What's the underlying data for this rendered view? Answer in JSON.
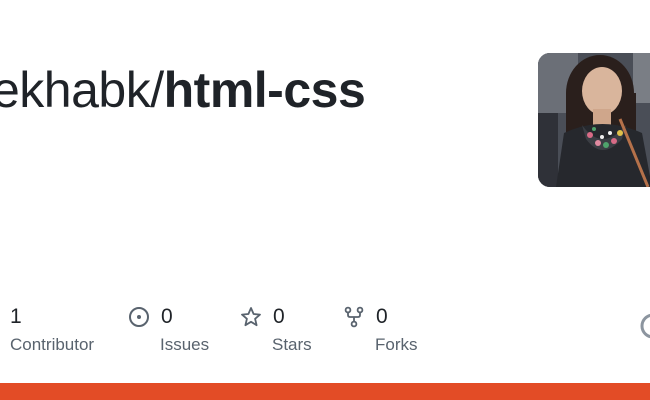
{
  "repo": {
    "owner": "ekhabk",
    "separator": "/",
    "name": "html-css"
  },
  "avatar": {
    "alt": "owner avatar"
  },
  "stats": [
    {
      "count": "1",
      "label": "Contributor",
      "icon": "people-icon"
    },
    {
      "count": "0",
      "label": "Issues",
      "icon": "issue-opened-icon"
    },
    {
      "count": "0",
      "label": "Stars",
      "icon": "star-icon"
    },
    {
      "count": "0",
      "label": "Forks",
      "icon": "repo-forked-icon"
    }
  ],
  "colors": {
    "text": "#1f2328",
    "muted": "#59636e",
    "icon": "#59636e",
    "accent_bar": "#e34c26"
  }
}
